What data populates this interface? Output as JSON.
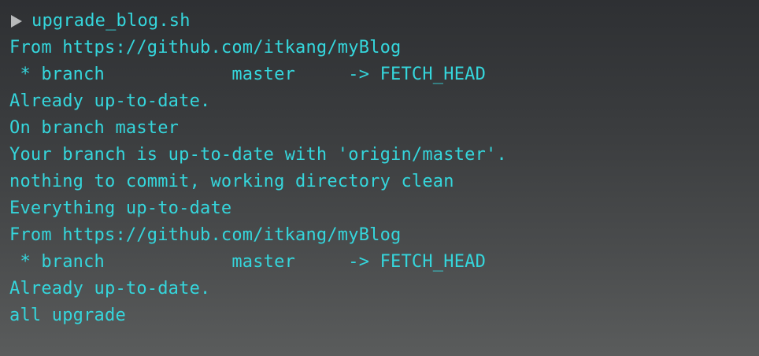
{
  "terminal": {
    "command": "upgrade_blog.sh",
    "prompt_icon": "play-triangle-icon",
    "text_color": "#35d6dc",
    "output": [
      "From https://github.com/itkang/myBlog",
      " * branch            master     -> FETCH_HEAD",
      "Already up-to-date.",
      "On branch master",
      "Your branch is up-to-date with 'origin/master'.",
      "nothing to commit, working directory clean",
      "Everything up-to-date",
      "From https://github.com/itkang/myBlog",
      " * branch            master     -> FETCH_HEAD",
      "Already up-to-date.",
      "all upgrade"
    ]
  }
}
